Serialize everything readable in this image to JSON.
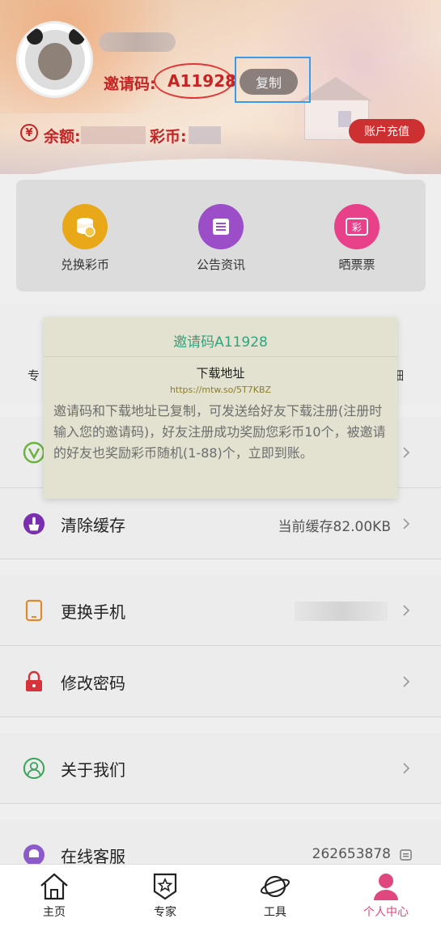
{
  "profile": {
    "invite_label": "邀请码:",
    "invite_code": "A11928",
    "copy_label": "复制",
    "balance_label": "余额:",
    "coin_label": "彩币:",
    "recharge_label": "账户充值"
  },
  "quick_actions": [
    {
      "label": "兑换彩币",
      "icon": "coins-icon",
      "color": "#e8a817"
    },
    {
      "label": "公告资讯",
      "icon": "news-icon",
      "color": "#9b4ec8"
    },
    {
      "label": "晒票票",
      "icon": "ticket-icon",
      "color": "#e8418a"
    }
  ],
  "row2": {
    "left": "专",
    "right": "细"
  },
  "list": [
    {
      "title": "清除缓存",
      "value": "当前缓存82.00KB",
      "icon": "broom-icon"
    },
    {
      "title": "更换手机",
      "value": "",
      "icon": "phone-icon"
    },
    {
      "title": "修改密码",
      "value": "",
      "icon": "lock-icon"
    },
    {
      "title": "关于我们",
      "value": "",
      "icon": "user-circle-icon"
    },
    {
      "title": "在线客服",
      "value": "262653878",
      "icon": "chat-icon"
    }
  ],
  "dialog": {
    "title": "邀请码A11928",
    "subtitle": "下载地址",
    "url": "https://mtw.so/5T7KBZ",
    "body": "邀请码和下载地址已复制，可发送给好友下载注册(注册时输入您的邀请码)，好友注册成功奖励您彩币10个，被邀请的好友也奖励彩币随机(1-88)个，立即到账。"
  },
  "tabs": [
    {
      "label": "主页",
      "icon": "home-icon"
    },
    {
      "label": "专家",
      "icon": "star-badge-icon"
    },
    {
      "label": "工具",
      "icon": "planet-icon"
    },
    {
      "label": "个人中心",
      "icon": "person-icon"
    }
  ],
  "colors": {
    "accent_red": "#c32525",
    "active_tab": "#e0477f",
    "dialog_title": "#2ea57e"
  }
}
